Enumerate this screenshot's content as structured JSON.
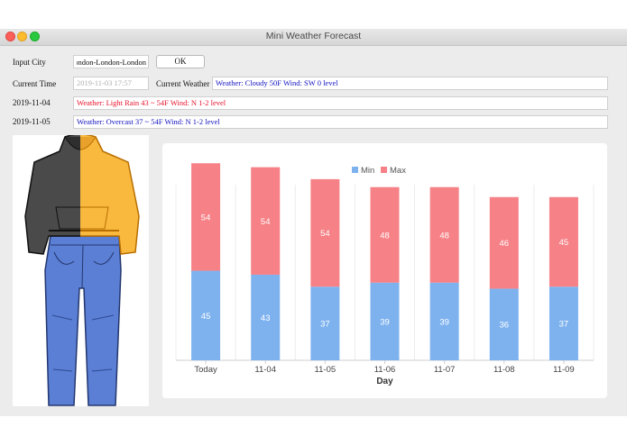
{
  "window": {
    "title": "Mini Weather Forecast"
  },
  "form": {
    "input_city_label": "Input City",
    "city_value": "London-London-London",
    "ok_label": "OK",
    "current_time_label": "Current Time",
    "current_time_value": "2019-11-03 17:57",
    "current_weather_label": "Current Weather",
    "current_weather_value": "Weather: Cloudy  50F  Wind: SW  0 level"
  },
  "forecast": [
    {
      "date": "2019-11-04",
      "text": "Weather: Light Rain  43 ~ 54F  Wind: N 1-2 level",
      "color": "#e8102a"
    },
    {
      "date": "2019-11-05",
      "text": "Weather: Overcast  37 ~ 54F  Wind: N 1-2 level",
      "color": "#1212c0"
    }
  ],
  "colors": {
    "min": "#7eb2ef",
    "max": "#f68186",
    "current_weather_text": "#1212c0",
    "placeholder_text": "#b0b0b0"
  },
  "clothing_image": {
    "icon": "hoodie-and-jeans-icon"
  },
  "chart_data": {
    "type": "bar",
    "stacked": true,
    "legend_position": "top-center",
    "grid": true,
    "xlabel": "Day",
    "ylabel": "",
    "categories": [
      "Today",
      "11-04",
      "11-05",
      "11-06",
      "11-07",
      "11-08",
      "11-09"
    ],
    "series": [
      {
        "name": "Min",
        "color": "#7eb2ef",
        "values": [
          45,
          43,
          37,
          39,
          39,
          36,
          37
        ]
      },
      {
        "name": "Max",
        "color": "#f68186",
        "values": [
          54,
          54,
          54,
          48,
          48,
          46,
          45
        ]
      }
    ],
    "ylim": [
      0,
      100
    ]
  }
}
